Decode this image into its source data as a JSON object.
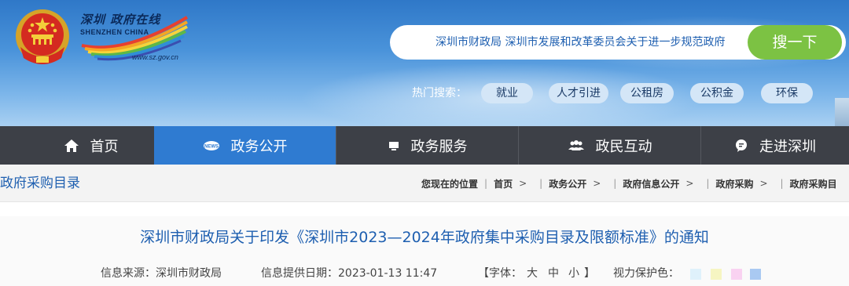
{
  "header": {
    "logo": {
      "title": "深圳 政府在线",
      "subtitle": "SHENZHEN CHINA",
      "url": "www.sz.gov.cn"
    },
    "search": {
      "value": "深圳市财政局 深圳市发展和改革委员会关于进一步规范政府",
      "button_label": "搜一下"
    },
    "hot_search": {
      "label": "热门搜索：",
      "tags": [
        "就业",
        "人才引进",
        "公租房",
        "公积金",
        "环保"
      ]
    }
  },
  "nav": {
    "items": [
      {
        "label": "首页",
        "icon": "home-icon"
      },
      {
        "label": "政务公开",
        "icon": "news-icon",
        "active": true
      },
      {
        "label": "政务服务",
        "icon": "monitor-icon"
      },
      {
        "label": "政民互动",
        "icon": "people-icon"
      },
      {
        "label": "走进深圳",
        "icon": "info-bubble-icon"
      }
    ]
  },
  "breadcrumb_bar": {
    "section_title": "政府采购目录",
    "location_label": "您现在的位置",
    "crumbs": [
      "首页",
      "政务公开",
      "政府信息公开",
      "政府采购",
      "政府采购目"
    ]
  },
  "article": {
    "title": "深圳市财政局关于印发《深圳市2023—2024年政府集中采购目录及限额标准》的通知",
    "source_label": "信息来源：深圳市财政局",
    "date_label": "信息提供日期：2023-01-13 11:47",
    "font_size_label": "【字体：",
    "font_sizes": [
      "大",
      "中",
      "小"
    ],
    "font_size_close": "】",
    "eye_care_label": "视力保护色：",
    "eye_care_colors": [
      "#dff1fb",
      "#f6f5c2",
      "#f9d2f1",
      "#a9c9f2"
    ]
  },
  "colors": {
    "accent_blue": "#2f7bd1",
    "search_button_green": "#7cc243",
    "nav_bg": "#3d4047",
    "title_blue": "#1e5fb0"
  }
}
